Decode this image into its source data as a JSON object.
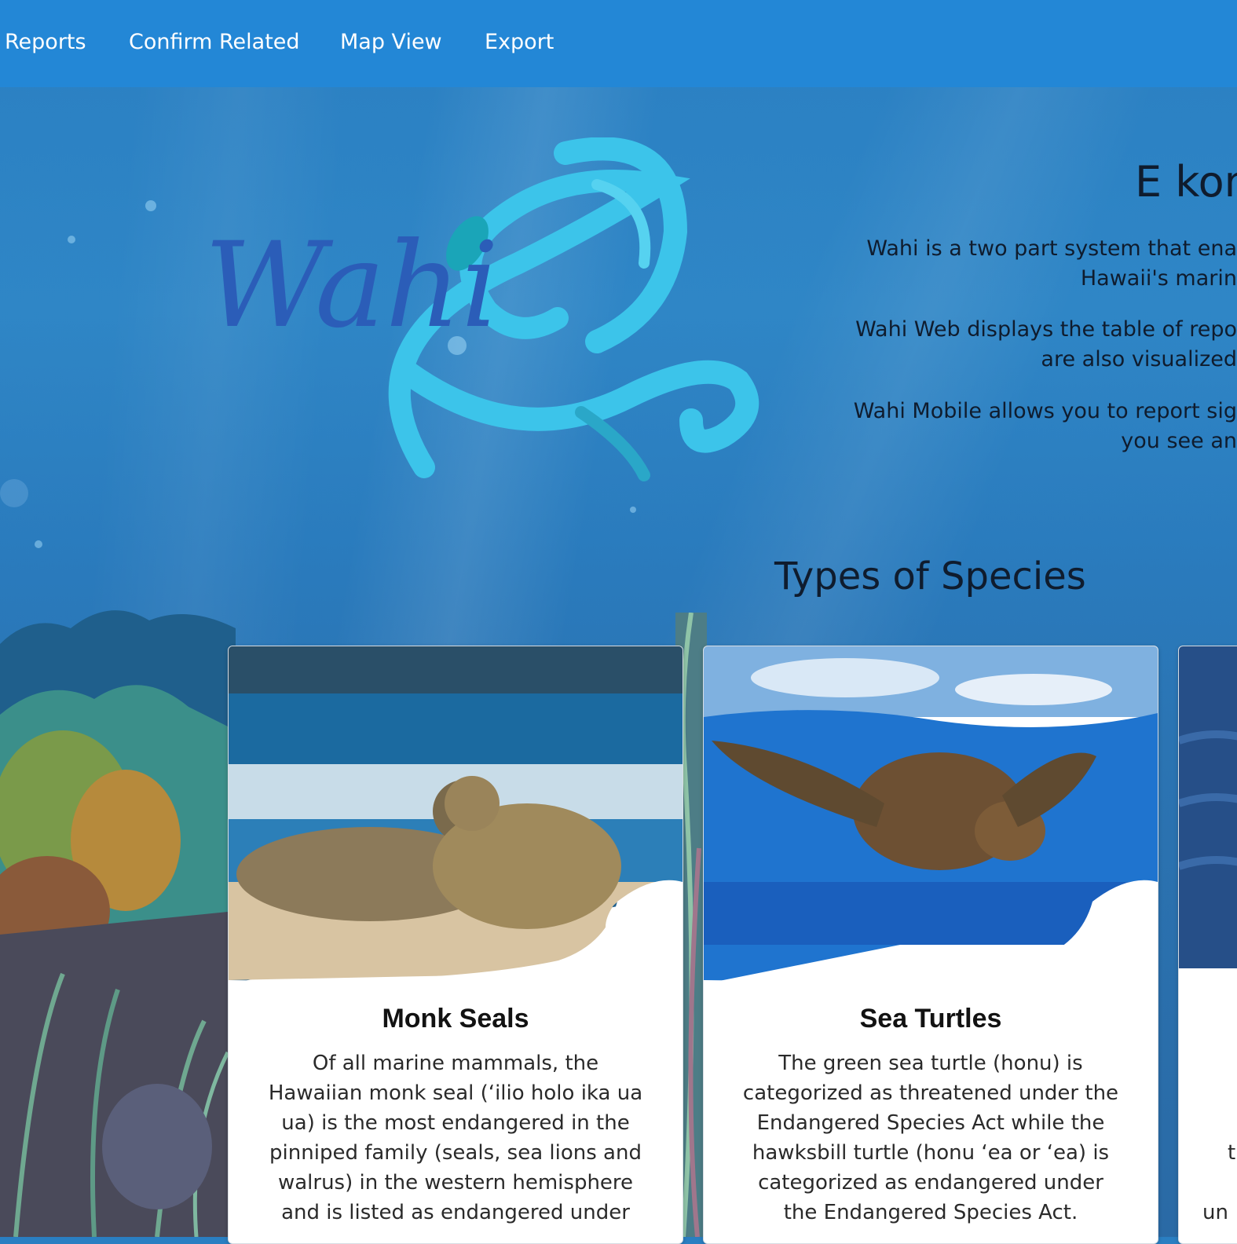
{
  "nav": {
    "items": [
      "Reports",
      "Confirm Related",
      "Map View",
      "Export"
    ],
    "color": "#2387d6"
  },
  "logo": {
    "text": "Wahi"
  },
  "intro": {
    "heading": "E kon",
    "paragraphs": [
      [
        "Wahi is a two part system that ena",
        "Hawaii's marin"
      ],
      [
        "Wahi Web displays the table of repo",
        "are also visualized"
      ],
      [
        "Wahi Mobile allows you to report sig",
        "you see an"
      ]
    ]
  },
  "species": {
    "title": "Types of Species",
    "cards": [
      {
        "name": "Monk Seals",
        "lines": [
          "Of all marine mammals, the",
          "Hawaiian monk seal (‘ilio holo ika ua",
          "ua) is the most endangered in the",
          "pinniped family (seals, sea lions and",
          "walrus) in the western hemisphere",
          "and is listed as endangered under"
        ],
        "image_icon": "monk-seals-photo"
      },
      {
        "name": "Sea Turtles",
        "lines": [
          "The green sea turtle (honu) is",
          "categorized as threatened under the",
          "Endangered Species Act while the",
          "hawksbill turtle (honu ‘ea or ‘ea) is",
          "categorized as endangered under",
          "the Endangered Species Act."
        ],
        "image_icon": "sea-turtle-photo"
      },
      {
        "name": "",
        "lines": [
          "",
          "",
          "",
          "t",
          "",
          "un"
        ],
        "image_icon": "ocean-photo"
      }
    ]
  },
  "colors": {
    "ocean": "#2a7bbd",
    "text_dark": "#0f1c2e",
    "logo_cyan": "#3cc4ea",
    "logo_blue": "#2b5db8"
  }
}
